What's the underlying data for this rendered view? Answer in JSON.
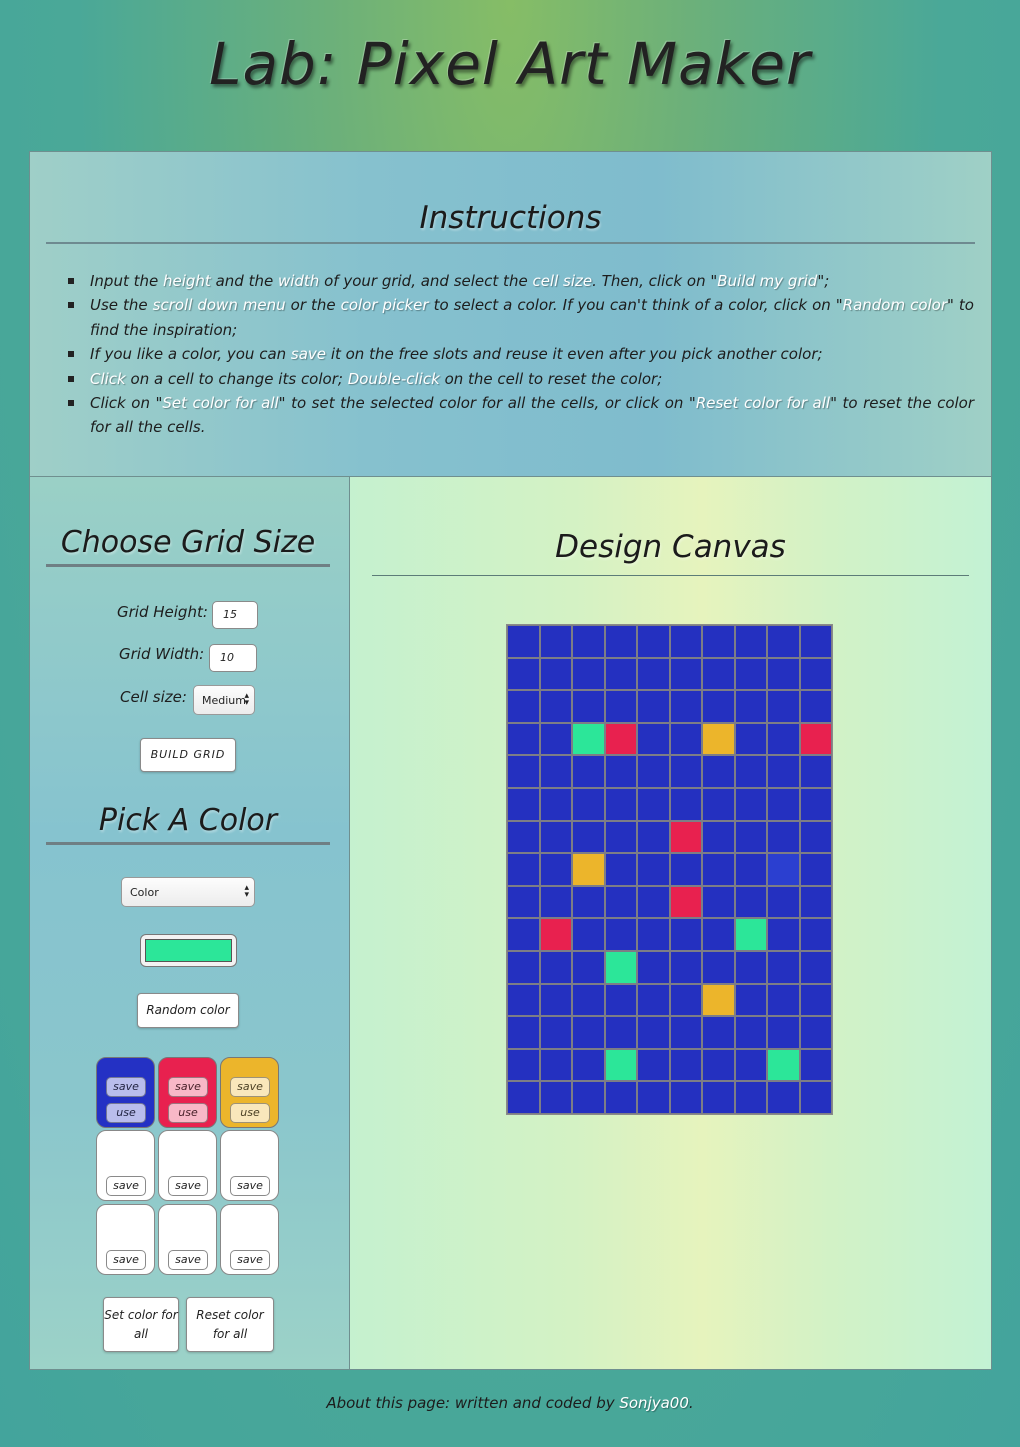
{
  "page": {
    "title": "Lab: Pixel Art Maker"
  },
  "instructions": {
    "title": "Instructions",
    "items": [
      [
        {
          "t": "Input the "
        },
        {
          "t": "height",
          "hl": true
        },
        {
          "t": " and the "
        },
        {
          "t": "width",
          "hl": true
        },
        {
          "t": " of your grid, and select the "
        },
        {
          "t": "cell size",
          "hl": true
        },
        {
          "t": ". Then, click on \""
        },
        {
          "t": "Build my grid",
          "hl": true
        },
        {
          "t": "\";"
        }
      ],
      [
        {
          "t": "Use the "
        },
        {
          "t": "scroll down menu",
          "hl": true
        },
        {
          "t": " or the "
        },
        {
          "t": "color picker",
          "hl": true
        },
        {
          "t": " to select a color. If you can't think of a color, click on \""
        },
        {
          "t": "Random color",
          "hl": true
        },
        {
          "t": "\" to find the inspiration;"
        }
      ],
      [
        {
          "t": "If you like a color, you can "
        },
        {
          "t": "save",
          "hl": true
        },
        {
          "t": " it on the free slots and reuse it even after you pick another color;"
        }
      ],
      [
        {
          "t": "Click",
          "hl": true
        },
        {
          "t": " on a cell to change its color; "
        },
        {
          "t": "Double-click",
          "hl": true
        },
        {
          "t": " on the cell to reset the color;"
        }
      ],
      [
        {
          "t": "Click on \""
        },
        {
          "t": "Set color for all",
          "hl": true
        },
        {
          "t": "\" to set the selected color for all the cells, or click on \""
        },
        {
          "t": "Reset color for all",
          "hl": true
        },
        {
          "t": "\" to reset the color for all the cells."
        }
      ]
    ]
  },
  "grid_size": {
    "title": "Choose Grid Size",
    "height_label": "Grid Height:",
    "height_value": "15",
    "width_label": "Grid Width:",
    "width_value": "10",
    "cell_size_label": "Cell size:",
    "cell_size_value": "Medium",
    "build_button": "BUILD GRID"
  },
  "pick_color": {
    "title": "Pick A Color",
    "color_select_value": "Color",
    "current_color": "#2ce699",
    "random_button": "Random color",
    "save_label": "save",
    "use_label": "use",
    "slots": [
      "#2431c4",
      "#e8214f",
      "#ecb52b",
      "",
      "",
      "",
      "",
      "",
      ""
    ],
    "set_all_button": "Set color for all",
    "reset_all_button": "Reset color for all"
  },
  "canvas": {
    "title": "Design Canvas",
    "rows": 15,
    "cols": 10,
    "default_color": "#2430c0",
    "painted_cells": [
      {
        "r": 3,
        "c": 2,
        "color": "#2ce699"
      },
      {
        "r": 3,
        "c": 3,
        "color": "#e8214f"
      },
      {
        "r": 3,
        "c": 6,
        "color": "#ecb52b"
      },
      {
        "r": 3,
        "c": 9,
        "color": "#e8214f"
      },
      {
        "r": 6,
        "c": 5,
        "color": "#e8214f"
      },
      {
        "r": 7,
        "c": 2,
        "color": "#ecb52b"
      },
      {
        "r": 7,
        "c": 8,
        "color": "#2b3fd0"
      },
      {
        "r": 8,
        "c": 5,
        "color": "#e8214f"
      },
      {
        "r": 9,
        "c": 1,
        "color": "#e8214f"
      },
      {
        "r": 9,
        "c": 7,
        "color": "#2ce699"
      },
      {
        "r": 10,
        "c": 3,
        "color": "#2ce699"
      },
      {
        "r": 11,
        "c": 6,
        "color": "#ecb52b"
      },
      {
        "r": 13,
        "c": 3,
        "color": "#2ce699"
      },
      {
        "r": 13,
        "c": 8,
        "color": "#2ce699"
      }
    ]
  },
  "footer": {
    "prefix": "About this page: written and coded by ",
    "author": "Sonjya00",
    "suffix": "."
  }
}
